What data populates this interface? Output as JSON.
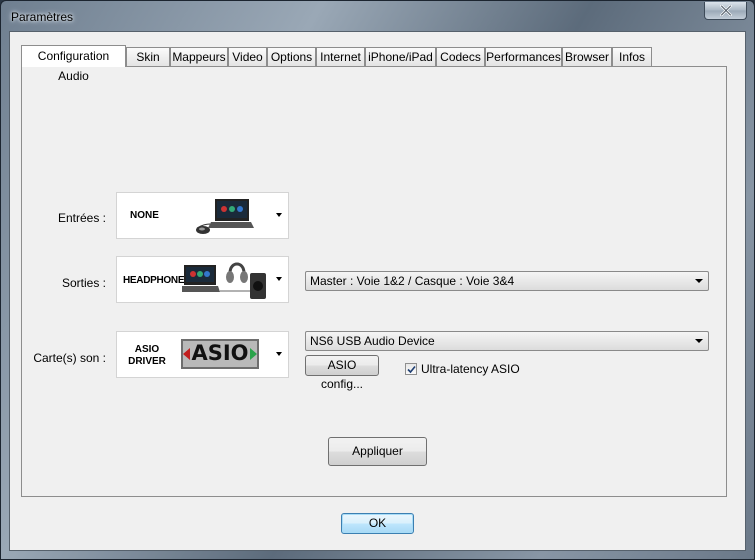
{
  "window": {
    "title": "Paramètres"
  },
  "tabs": [
    {
      "label": "Configuration Audio",
      "active": true
    },
    {
      "label": "Skin"
    },
    {
      "label": "Mappeurs"
    },
    {
      "label": "Video"
    },
    {
      "label": "Options"
    },
    {
      "label": "Internet"
    },
    {
      "label": "iPhone/iPad"
    },
    {
      "label": "Codecs"
    },
    {
      "label": "Performances"
    },
    {
      "label": "Browser"
    },
    {
      "label": "Infos"
    }
  ],
  "audio": {
    "inputs": {
      "label": "Entrées :",
      "device": "NONE"
    },
    "outputs": {
      "label": "Sorties :",
      "device": "HEADPHONES",
      "routing": "Master : Voie 1&2 / Casque : Voie 3&4"
    },
    "soundcard": {
      "label": "Carte(s) son :",
      "device_line1": "ASIO",
      "device_line2": "DRIVER",
      "logo_text": "ASIO",
      "device_name": "NS6 USB Audio Device",
      "config_button": "ASIO config...",
      "ultra_latency_label": "Ultra-latency ASIO",
      "ultra_latency_checked": true
    },
    "apply_button": "Appliquer"
  },
  "footer": {
    "ok_button": "OK"
  },
  "colors": {
    "accent": "#3c7fb1",
    "asio_red": "#c21f1f",
    "asio_green": "#2aa34a"
  }
}
